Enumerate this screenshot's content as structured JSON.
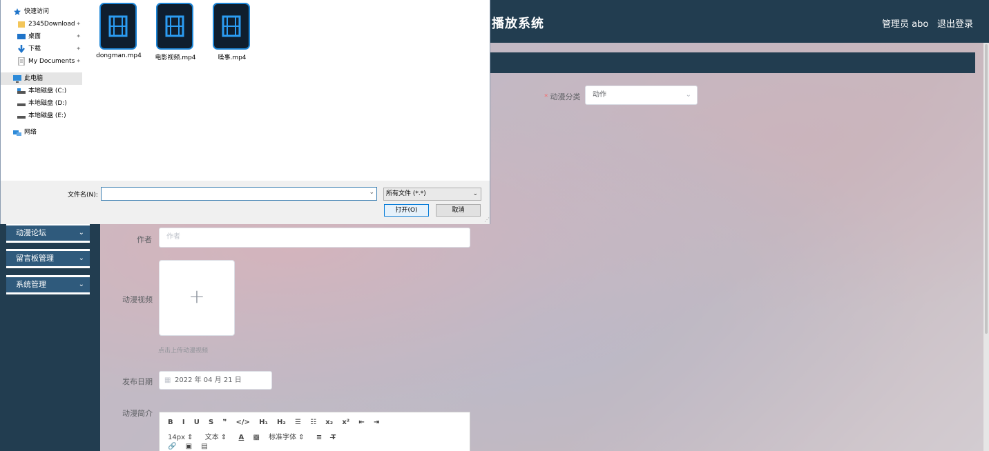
{
  "app": {
    "title_fragment": "播放系统",
    "user_label": "管理员 abo",
    "logout_label": "退出登录",
    "sidebar": [
      {
        "label": "动漫论坛"
      },
      {
        "label": "留言板管理"
      },
      {
        "label": "系统管理"
      }
    ],
    "form": {
      "category_label": "动漫分类",
      "category_value": "动作",
      "author_label": "作者",
      "author_placeholder": "作者",
      "video_label": "动漫视频",
      "upload_tip": "点击上传动漫视频",
      "date_label": "发布日期",
      "date_value": "2022 年 04 月 21 日",
      "intro_label": "动漫简介",
      "editor": {
        "row1": [
          "B",
          "I",
          "U",
          "S",
          "❞",
          "</>",
          "H₁",
          "H₂",
          "☰",
          "☷",
          "x₂",
          "x²",
          "⇤",
          "⇥"
        ],
        "font_size": "14px",
        "text_type": "文本",
        "font_family": "标准字体"
      }
    }
  },
  "dialog": {
    "nav": [
      {
        "label": "快速访问",
        "icon": "star-icon"
      },
      {
        "label": "2345Download",
        "icon": "folder-icon",
        "pinned": true
      },
      {
        "label": "桌面",
        "icon": "desktop-icon",
        "pinned": true
      },
      {
        "label": "下载",
        "icon": "download-icon",
        "pinned": true
      },
      {
        "label": "My Documents",
        "icon": "document-icon",
        "pinned": true
      },
      {
        "label": "此电脑",
        "icon": "computer-icon"
      },
      {
        "label": "本地磁盘 (C:)",
        "icon": "drive-icon"
      },
      {
        "label": "本地磁盘 (D:)",
        "icon": "drive-icon"
      },
      {
        "label": "本地磁盘 (E:)",
        "icon": "drive-icon"
      },
      {
        "label": "网络",
        "icon": "network-icon"
      }
    ],
    "files": [
      {
        "name": "dongman.mp4"
      },
      {
        "name": "电影视频.mp4"
      },
      {
        "name": "噪事.mp4"
      }
    ],
    "filename_label": "文件名(N):",
    "filename_value": "",
    "filetype_value": "所有文件 (*.*)",
    "open_label": "打开(O)",
    "cancel_label": "取消",
    "pin_glyph": "📌"
  }
}
